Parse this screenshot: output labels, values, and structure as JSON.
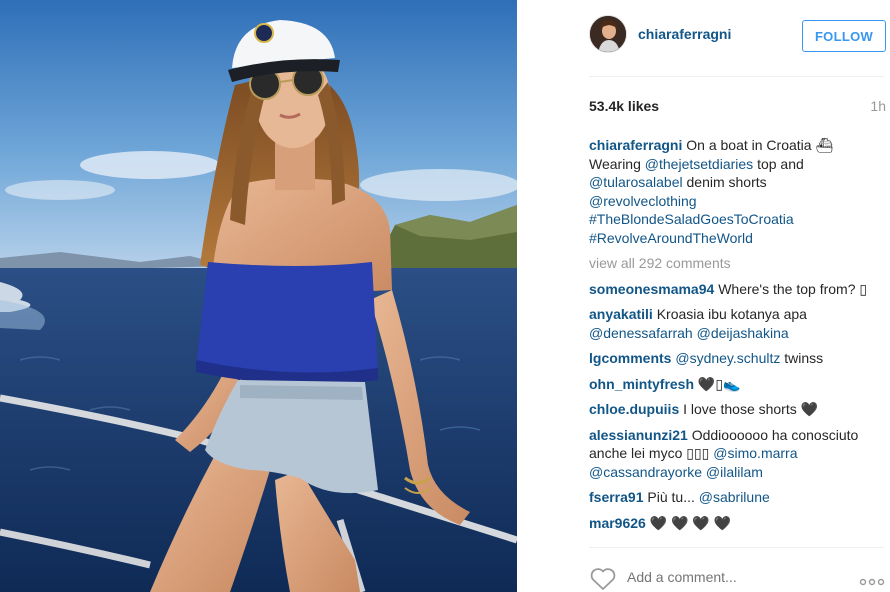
{
  "post": {
    "author": "chiaraferragni",
    "follow_label": "FOLLOW",
    "likes": "53.4k likes",
    "time": "1h"
  },
  "caption": {
    "author": "chiaraferragni",
    "line1": "On a boat in Croatia ⛴",
    "wearing": "Wearing",
    "mention1": "@thejetsetdiaries",
    "top_and": "top and",
    "mention2": "@tularosalabel",
    "denim": "denim shorts",
    "mention3": "@revolveclothing",
    "hashtag1": "#TheBlondeSaladGoesToCroatia",
    "hashtag2": "#RevolveAroundTheWorld"
  },
  "view_all": "view all 292 comments",
  "comments": [
    {
      "user": "someonesmama94",
      "text": "Where's the top from? ▯"
    },
    {
      "user": "anyakatili",
      "text": "Kroasia ibu kotanya apa",
      "mentions": "@denessafarrah @deijashakina"
    },
    {
      "user": "lgcomments",
      "mentions": "@sydney.schultz",
      "text": "twinss"
    },
    {
      "user": "ohn_mintyfresh",
      "text": "🖤▯👟"
    },
    {
      "user": "chloe.dupuiis",
      "text": "I love those shorts 🖤"
    },
    {
      "user": "alessianunzi21",
      "text": "Oddioooooo ha conosciuto anche lei myco ▯▯▯",
      "mentions": "@simo.marra @cassandrayorke @ilalilam"
    },
    {
      "user": "fserra91",
      "text": "Più tu...",
      "mentions": "@sabrilune"
    },
    {
      "user": "mar9626",
      "text": "🖤 🖤 🖤 🖤"
    }
  ],
  "add_comment_placeholder": "Add a comment...",
  "colors": {
    "link": "#125688",
    "follow_blue": "#3897f0",
    "muted": "#999999",
    "sea": "#1d3f73",
    "sky": "#3f7fc4",
    "top": "#2a3fb0"
  },
  "icons": {
    "like": "heart-outline-icon",
    "more": "more-dots-icon"
  }
}
